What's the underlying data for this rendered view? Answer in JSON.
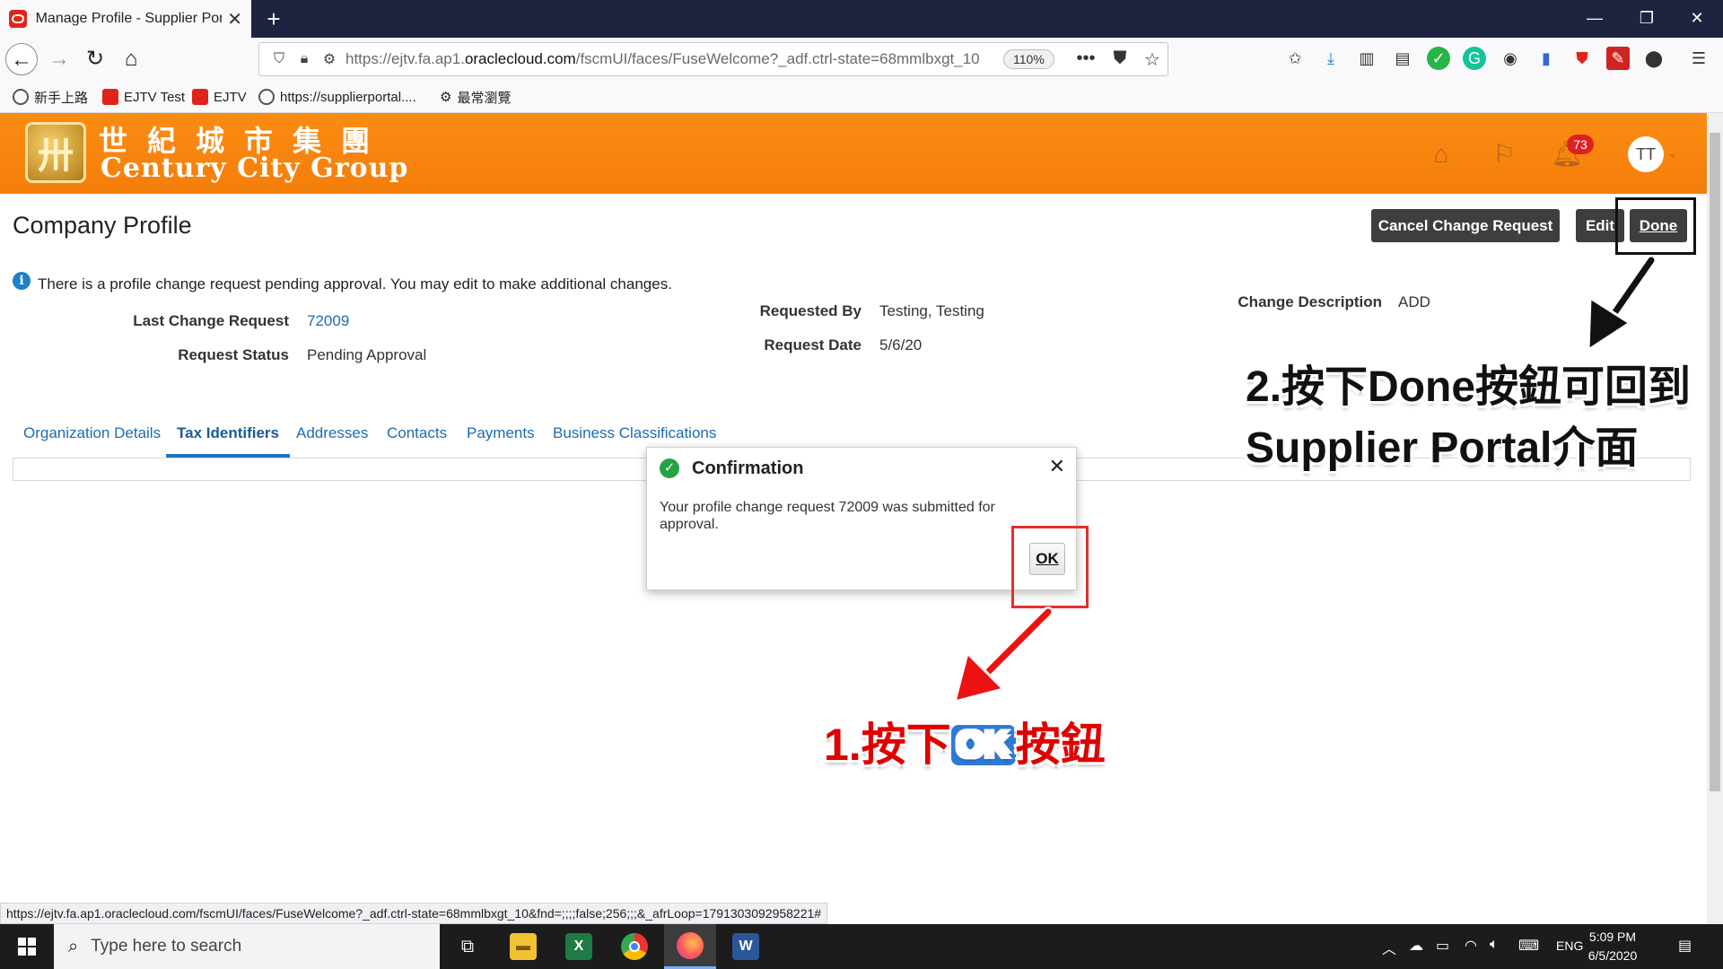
{
  "browser": {
    "tab_title": "Manage Profile - Supplier Portal",
    "url_prefix": "https://ejtv.fa.ap1.",
    "url_domain": "oraclecloud.com",
    "url_rest": "/fscmUI/faces/FuseWelcome?_adf.ctrl-state=68mmlbxgt_10",
    "zoom": "110%",
    "bookmarks": [
      {
        "label": "新手上路",
        "icon": "globe-icon"
      },
      {
        "label": "EJTV Test",
        "icon": "oracle-icon"
      },
      {
        "label": "EJTV",
        "icon": "oracle-icon"
      },
      {
        "label": "https://supplierportal....",
        "icon": "globe-icon"
      },
      {
        "label": "最常瀏覽",
        "icon": "gear-icon"
      }
    ],
    "status_url": "https://ejtv.fa.ap1.oraclecloud.com/fscmUI/faces/FuseWelcome?_adf.ctrl-state=68mmlbxgt_10&fnd=;;;;false;256;;;&_afrLoop=1791303092958221#"
  },
  "header": {
    "logo_cn": "世紀城市集團",
    "logo_en": "Century City Group",
    "notification_count": "73",
    "avatar_initials": "TT"
  },
  "page": {
    "title": "Company Profile",
    "buttons": {
      "cancel": "Cancel Change Request",
      "edit": "Edit",
      "done": "Done"
    },
    "info_message": "There is a profile change request pending approval. You may edit to make additional changes.",
    "fields": {
      "last_change_request_label": "Last Change Request",
      "last_change_request_value": "72009",
      "request_status_label": "Request Status",
      "request_status_value": "Pending Approval",
      "requested_by_label": "Requested By",
      "requested_by_value": "Testing, Testing",
      "request_date_label": "Request Date",
      "request_date_value": "5/6/20",
      "change_description_label": "Change Description",
      "change_description_value": "ADD"
    },
    "tabs": [
      {
        "label": "Organization Details",
        "active": false
      },
      {
        "label": "Tax Identifiers",
        "active": true
      },
      {
        "label": "Addresses",
        "active": false
      },
      {
        "label": "Contacts",
        "active": false
      },
      {
        "label": "Payments",
        "active": false
      },
      {
        "label": "Business Classifications",
        "active": false
      }
    ]
  },
  "dialog": {
    "title": "Confirmation",
    "message": "Your profile change request 72009 was submitted for approval.",
    "ok_label": "OK"
  },
  "annotations": {
    "step1_prefix": "1.按下",
    "step1_ok": "OK",
    "step1_suffix": "按鈕",
    "step2_line1": "2.按下Done按鈕可回到",
    "step2_line2": "Supplier Portal介面"
  },
  "taskbar": {
    "search_placeholder": "Type here to search",
    "language": "ENG",
    "time": "5:09 PM",
    "date": "6/5/2020"
  }
}
